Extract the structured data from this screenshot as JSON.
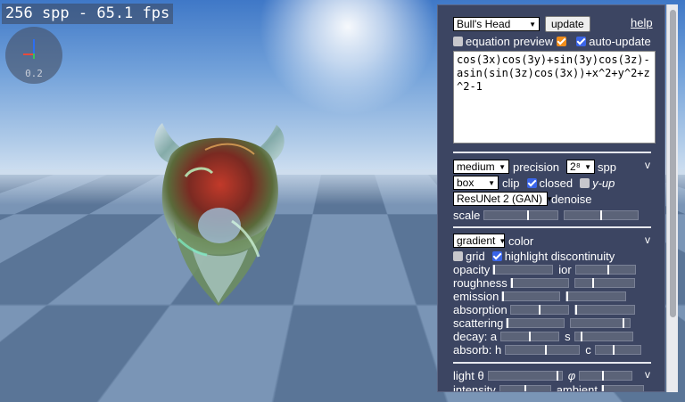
{
  "hud": {
    "fps_text": "256 spp - 65.1 fps",
    "axis_scale": "0.2"
  },
  "panel": {
    "preset": "Bull's Head",
    "update_label": "update",
    "help_label": "help",
    "equation_preview_label": "equation preview",
    "equation_preview_checked": false,
    "extra_checked": true,
    "auto_update_label": "auto-update",
    "auto_update_checked": true,
    "equation": "cos(3x)cos(3y)+sin(3y)cos(3z)-asin(sin(3z)cos(3x))+x^2+y^2+z^2-1",
    "render": {
      "precision_value": "medium",
      "precision_label": "precision",
      "spp_value": "2⁸",
      "spp_label": "spp",
      "clip_value": "box",
      "clip_label": "clip",
      "closed_label": "closed",
      "closed_checked": true,
      "yup_label": "y-up",
      "yup_checked": false,
      "denoise_value": "ResUNet 2 (GAN)",
      "denoise_label": "denoise",
      "scale_label": "scale",
      "collapse_label": "v"
    },
    "material": {
      "color_value": "gradient",
      "color_label": "color",
      "grid_label": "grid",
      "grid_checked": false,
      "highlight_label": "highlight discontinuity",
      "highlight_checked": true,
      "opacity_label": "opacity",
      "ior_label": "ior",
      "roughness_label": "roughness",
      "emission_label": "emission",
      "absorption_label": "absorption",
      "scattering_label": "scattering",
      "decay_label": "decay: a",
      "decay_s_label": "s",
      "absorb_label": "absorb: h",
      "absorb_c_label": "c",
      "collapse_label": "v"
    },
    "light": {
      "theta_label": "light θ",
      "phi_label": "φ",
      "intensity_label": "intensity",
      "ambient_label": "ambient",
      "collapse_label": "v"
    },
    "sliders": {
      "scale_a": 0.6,
      "scale_b": 0.5,
      "opacity": 0.0,
      "ior": 0.55,
      "roughness": 0.0,
      "roughness_b": 0.3,
      "emission": 0.0,
      "emission_b": 0.0,
      "absorption": 0.5,
      "absorption_b": 0.0,
      "scattering": 0.0,
      "scattering_b": 0.9,
      "decay_a": 0.5,
      "decay_s": 0.1,
      "absorb_h": 0.55,
      "absorb_c": 0.4,
      "theta": 0.95,
      "phi": 0.45,
      "intensity": 0.5,
      "ambient": 0.0
    }
  }
}
